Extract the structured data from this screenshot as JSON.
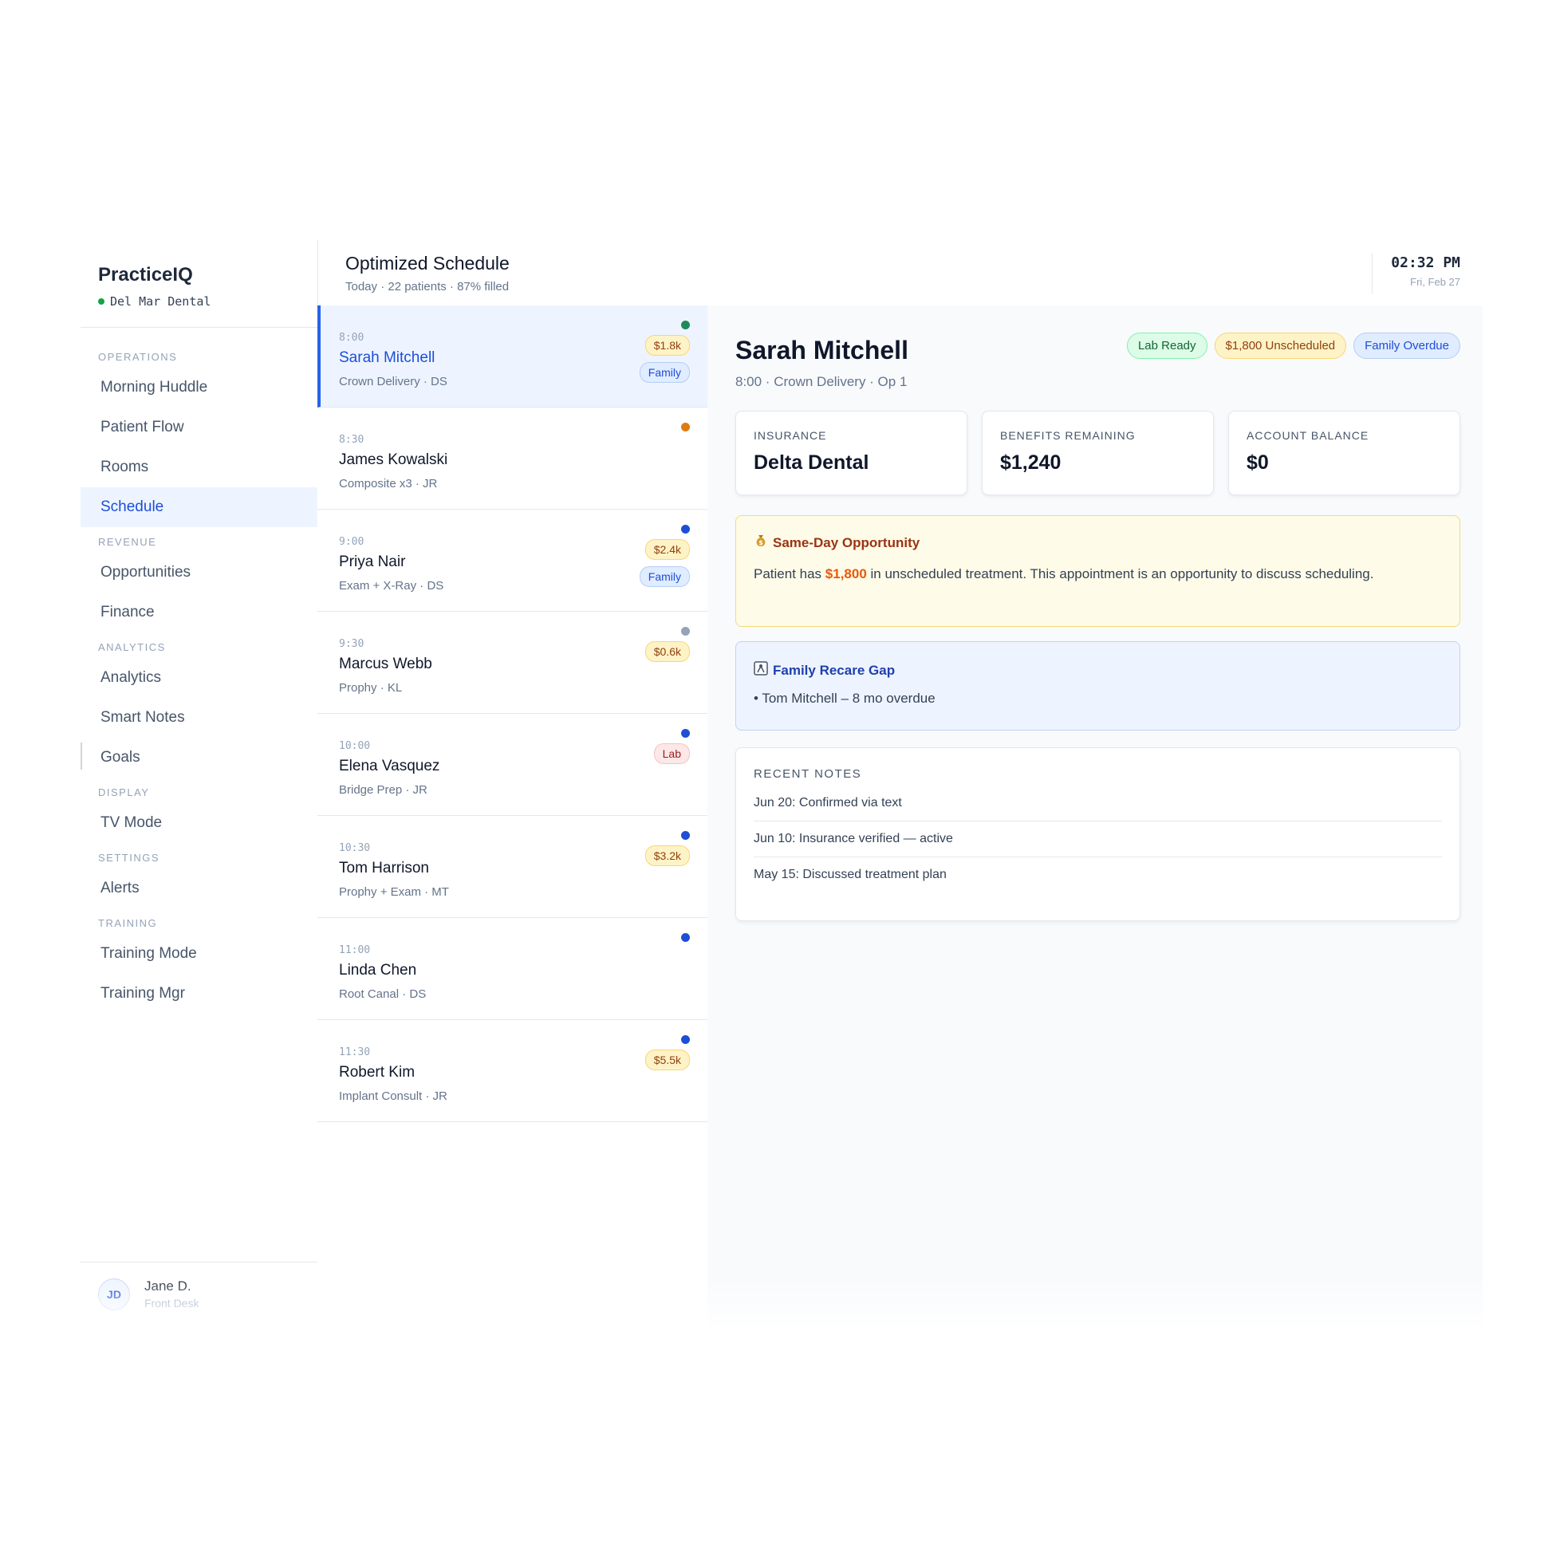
{
  "brand": {
    "name": "PracticeIQ",
    "location": "Del Mar Dental"
  },
  "nav": {
    "sections": [
      {
        "label": "OPERATIONS",
        "items": [
          "Morning Huddle",
          "Patient Flow",
          "Rooms",
          "Schedule"
        ]
      },
      {
        "label": "REVENUE",
        "items": [
          "Opportunities",
          "Finance"
        ]
      },
      {
        "label": "ANALYTICS",
        "items": [
          "Analytics",
          "Smart Notes",
          "Goals"
        ]
      },
      {
        "label": "DISPLAY",
        "items": [
          "TV Mode"
        ]
      },
      {
        "label": "SETTINGS",
        "items": [
          "Alerts"
        ]
      },
      {
        "label": "TRAINING",
        "items": [
          "Training Mode",
          "Training Mgr"
        ]
      }
    ],
    "active": "Schedule"
  },
  "user": {
    "initials": "JD",
    "name": "Jane D.",
    "role": "Front Desk"
  },
  "header": {
    "title": "Optimized Schedule",
    "subtitle": "Today · 22 patients · 87% filled",
    "time": "02:32 PM",
    "date": "Fri, Feb 27"
  },
  "patients": [
    {
      "time": "8:00",
      "name": "Sarah Mitchell",
      "procedure": "Crown Delivery · DS",
      "dot": "#1f8a5b",
      "amount": "$1.8k",
      "family": "Family",
      "selected": true
    },
    {
      "time": "8:30",
      "name": "James Kowalski",
      "procedure": "Composite x3 · JR",
      "dot": "#e07b0f"
    },
    {
      "time": "9:00",
      "name": "Priya Nair",
      "procedure": "Exam + X-Ray · DS",
      "dot": "#1d4ed8",
      "amount": "$2.4k",
      "family": "Family"
    },
    {
      "time": "9:30",
      "name": "Marcus Webb",
      "procedure": "Prophy · KL",
      "dot": "#94a3b8",
      "amount": "$0.6k"
    },
    {
      "time": "10:00",
      "name": "Elena Vasquez",
      "procedure": "Bridge Prep · JR",
      "dot": "#1d4ed8",
      "lab": "Lab"
    },
    {
      "time": "10:30",
      "name": "Tom Harrison",
      "procedure": "Prophy + Exam · MT",
      "dot": "#1d4ed8",
      "amount": "$3.2k"
    },
    {
      "time": "11:00",
      "name": "Linda Chen",
      "procedure": "Root Canal · DS",
      "dot": "#1d4ed8"
    },
    {
      "time": "11:30",
      "name": "Robert Kim",
      "procedure": "Implant Consult · JR",
      "dot": "#1d4ed8",
      "amount": "$5.5k"
    }
  ],
  "detail": {
    "name": "Sarah Mitchell",
    "subtitle": "8:00 · Crown Delivery · Op 1",
    "tags": [
      {
        "label": "Lab Ready",
        "style": "green"
      },
      {
        "label": "$1,800 Unscheduled",
        "style": "yellow"
      },
      {
        "label": "Family Overdue",
        "style": "blue"
      }
    ],
    "cards": [
      {
        "label": "INSURANCE",
        "value": "Delta Dental"
      },
      {
        "label": "BENEFITS REMAINING",
        "value": "$1,240"
      },
      {
        "label": "ACCOUNT BALANCE",
        "value": "$0"
      }
    ],
    "opportunity": {
      "icon": "money-bag-icon",
      "title": "Same-Day Opportunity",
      "body_before": "Patient has ",
      "amount": "$1,800",
      "body_after": " in unscheduled treatment. This appointment is an opportunity to discuss scheduling."
    },
    "recare": {
      "icon": "family-icon",
      "title": "Family Recare Gap",
      "items": [
        "• Tom Mitchell – 8 mo overdue"
      ]
    },
    "notes": {
      "title": "RECENT NOTES",
      "items": [
        "Jun 20: Confirmed via text",
        "Jun 10: Insurance verified — active",
        "May 15: Discussed treatment plan"
      ]
    }
  }
}
